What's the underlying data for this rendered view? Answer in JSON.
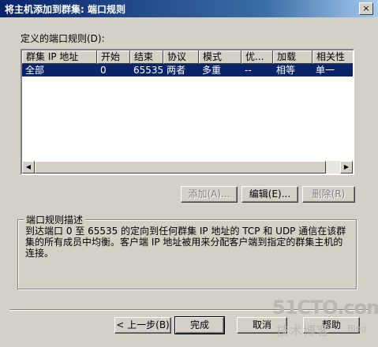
{
  "window": {
    "title": "将主机添加到群集:  端口规则",
    "close_glyph": "×"
  },
  "port_rules": {
    "label": "定义的端口规则(D):",
    "columns": [
      "群集 IP 地址",
      "开始",
      "结束",
      "协议",
      "模式",
      "优...",
      "加载",
      "相关性"
    ],
    "rows": [
      [
        "全部",
        "0",
        "65535",
        "两者",
        "多重",
        "--",
        "相等",
        "单一"
      ]
    ],
    "selected_row": 0
  },
  "rule_buttons": {
    "add": "添加(A)...",
    "edit": "编辑(E)...",
    "remove": "删除(R)"
  },
  "description": {
    "title": "端口规则描述",
    "text": "到达端口 0 至 65535 的定向到任何群集 IP 地址的 TCP 和 UDP 通信在该群集的所有成员中均衡。客户端 IP 地址被用来分配客户端到指定的群集主机的连接。"
  },
  "nav_buttons": {
    "back": "< 上一步(B)",
    "finish": "完成",
    "cancel": "取消",
    "help": "帮助"
  },
  "watermark": {
    "main": "51CTO.com",
    "sub": "技术博客",
    "blog": "Blog"
  }
}
